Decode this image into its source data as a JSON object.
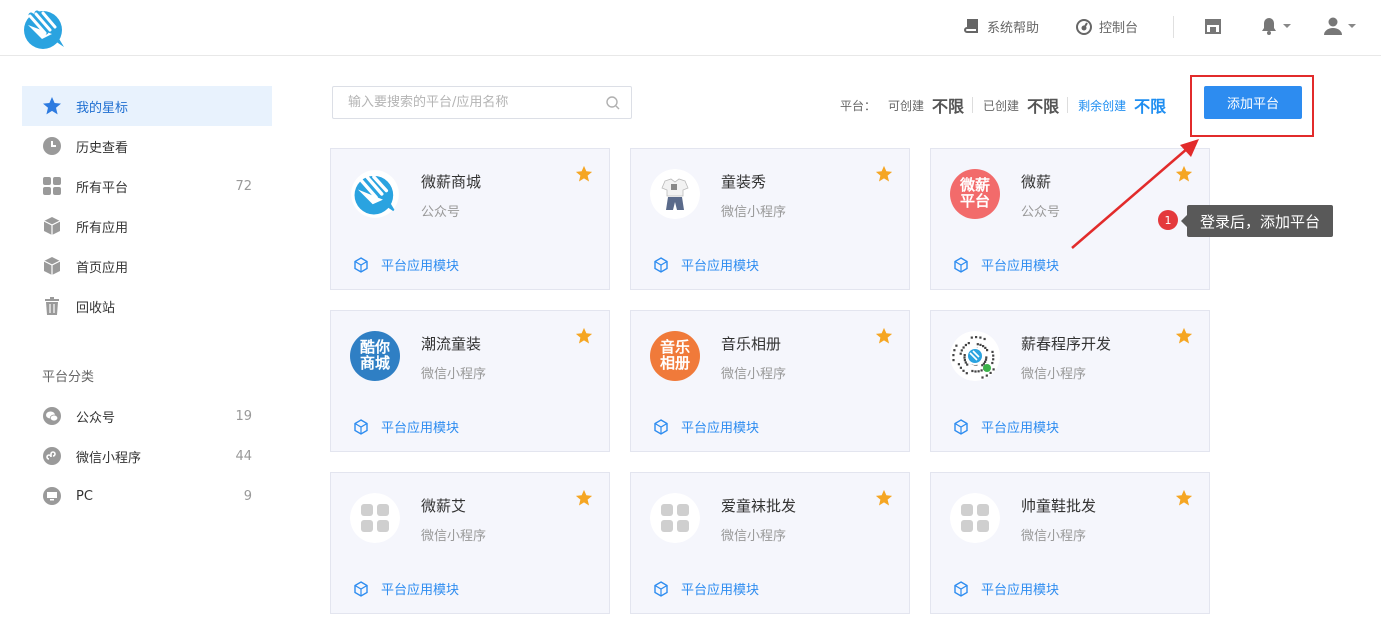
{
  "header": {
    "help_label": "系统帮助",
    "console_label": "控制台"
  },
  "sidebar": {
    "items": [
      {
        "label": "我的星标",
        "icon": "star-icon",
        "active": true
      },
      {
        "label": "历史查看",
        "icon": "clock-icon"
      },
      {
        "label": "所有平台",
        "icon": "grid-icon",
        "count": "72"
      },
      {
        "label": "所有应用",
        "icon": "cube-icon"
      },
      {
        "label": "首页应用",
        "icon": "cube-icon"
      },
      {
        "label": "回收站",
        "icon": "trash-icon"
      }
    ],
    "category_heading": "平台分类",
    "categories": [
      {
        "label": "公众号",
        "icon": "wechat-icon",
        "count": "19"
      },
      {
        "label": "微信小程序",
        "icon": "miniprogram-icon",
        "count": "44"
      },
      {
        "label": "PC",
        "icon": "monitor-icon",
        "count": "9"
      }
    ]
  },
  "toolbar": {
    "search_placeholder": "输入要搜索的平台/应用名称",
    "platform_label": "平台：",
    "can_create_label": "可创建",
    "can_create_value": "不限",
    "created_label": "已创建",
    "created_value": "不限",
    "remaining_label": "剩余创建",
    "remaining_value": "不限",
    "add_button": "添加平台"
  },
  "cards": [
    {
      "name": "微薪商城",
      "type": "公众号",
      "module": "平台应用模块",
      "avatar": "logo"
    },
    {
      "name": "童装秀",
      "type": "微信小程序",
      "module": "平台应用模块",
      "avatar": "clothes"
    },
    {
      "name": "微薪",
      "type": "公众号",
      "module": "平台应用模块",
      "avatar": "text",
      "avatar_text": [
        "微薪",
        "平台"
      ],
      "avatar_color": "#f26b6b"
    },
    {
      "name": "潮流童装",
      "type": "微信小程序",
      "module": "平台应用模块",
      "avatar": "text",
      "avatar_text": [
        "酷你",
        "商城"
      ],
      "avatar_color": "#2f7fc4"
    },
    {
      "name": "音乐相册",
      "type": "微信小程序",
      "module": "平台应用模块",
      "avatar": "text",
      "avatar_text": [
        "音乐",
        "相册"
      ],
      "avatar_color": "#f07a3a"
    },
    {
      "name": "薪春程序开发",
      "type": "微信小程序",
      "module": "平台应用模块",
      "avatar": "qrcode"
    },
    {
      "name": "微薪艾",
      "type": "微信小程序",
      "module": "平台应用模块",
      "avatar": "placeholder"
    },
    {
      "name": "爱童袜批发",
      "type": "微信小程序",
      "module": "平台应用模块",
      "avatar": "placeholder"
    },
    {
      "name": "帅童鞋批发",
      "type": "微信小程序",
      "module": "平台应用模块",
      "avatar": "placeholder"
    }
  ],
  "tooltip": {
    "badge": "1",
    "text": "登录后，添加平台"
  },
  "colors": {
    "accent": "#2d8cf0",
    "highlight_frame": "#e22b2b",
    "star": "#f5a623"
  }
}
